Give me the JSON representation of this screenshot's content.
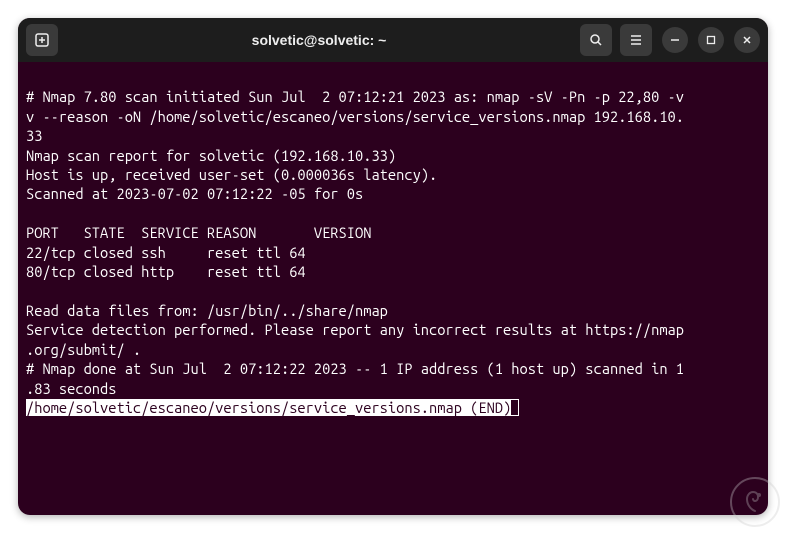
{
  "titlebar": {
    "title": "solvetic@solvetic: ~"
  },
  "term": {
    "l1": "# Nmap 7.80 scan initiated Sun Jul  2 07:12:21 2023 as: nmap -sV -Pn -p 22,80 -v",
    "l2": "v --reason -oN /home/solvetic/escaneo/versions/service_versions.nmap 192.168.10.",
    "l3": "33",
    "l4": "Nmap scan report for solvetic (192.168.10.33)",
    "l5": "Host is up, received user-set (0.000036s latency).",
    "l6": "Scanned at 2023-07-02 07:12:22 -05 for 0s",
    "l7": "",
    "l8": "PORT   STATE  SERVICE REASON       VERSION",
    "l9": "22/tcp closed ssh     reset ttl 64",
    "l10": "80/tcp closed http    reset ttl 64",
    "l11": "",
    "l12": "Read data files from: /usr/bin/../share/nmap",
    "l13": "Service detection performed. Please report any incorrect results at https://nmap",
    "l14": ".org/submit/ .",
    "l15": "# Nmap done at Sun Jul  2 07:12:22 2023 -- 1 IP address (1 host up) scanned in 1",
    "l16": ".83 seconds",
    "status": "/home/solvetic/escaneo/versions/service_versions.nmap (END)"
  }
}
